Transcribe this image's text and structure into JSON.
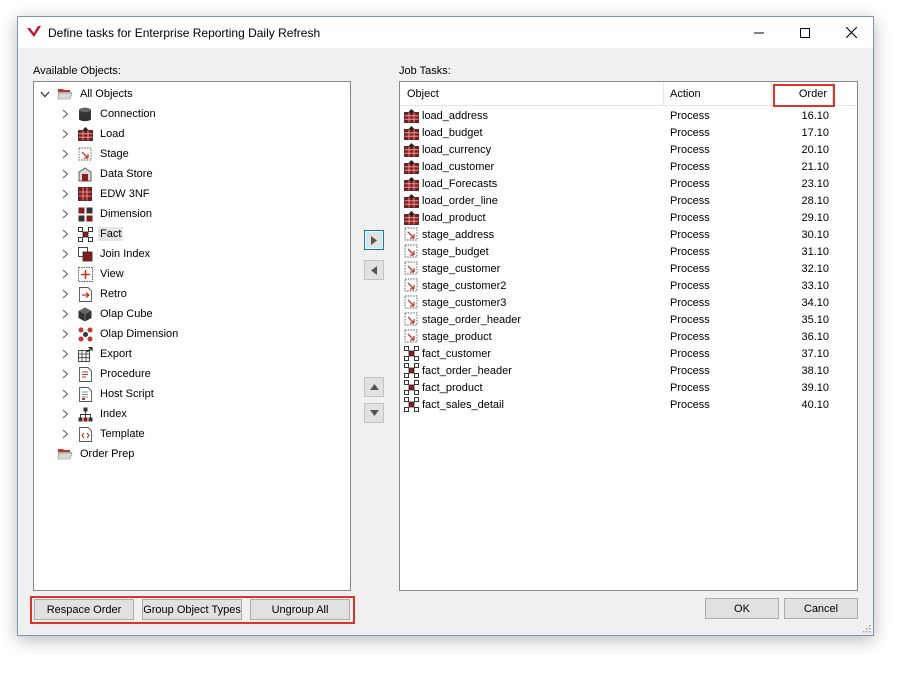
{
  "window": {
    "title": "Define tasks for Enterprise Reporting Daily Refresh"
  },
  "left": {
    "label": "Available Objects:",
    "tree": [
      {
        "label": "All Objects",
        "icon": "folder-icon",
        "expanded": true,
        "level": 0
      },
      {
        "label": "Connection",
        "icon": "connection-icon",
        "level": 1
      },
      {
        "label": "Load",
        "icon": "load-table-icon",
        "level": 1
      },
      {
        "label": "Stage",
        "icon": "stage-table-icon",
        "level": 1
      },
      {
        "label": "Data Store",
        "icon": "data-store-icon",
        "level": 1
      },
      {
        "label": "EDW 3NF",
        "icon": "edw-3nf-icon",
        "level": 1
      },
      {
        "label": "Dimension",
        "icon": "dimension-icon",
        "level": 1
      },
      {
        "label": "Fact",
        "icon": "fact-icon",
        "level": 1,
        "selected": true
      },
      {
        "label": "Join Index",
        "icon": "join-index-icon",
        "level": 1
      },
      {
        "label": "View",
        "icon": "view-icon",
        "level": 1
      },
      {
        "label": "Retro",
        "icon": "retro-icon",
        "level": 1
      },
      {
        "label": "Olap Cube",
        "icon": "olap-cube-icon",
        "level": 1
      },
      {
        "label": "Olap Dimension",
        "icon": "olap-dimension-icon",
        "level": 1
      },
      {
        "label": "Export",
        "icon": "export-icon",
        "level": 1
      },
      {
        "label": "Procedure",
        "icon": "procedure-icon",
        "level": 1
      },
      {
        "label": "Host Script",
        "icon": "host-script-icon",
        "level": 1
      },
      {
        "label": "Index",
        "icon": "index-icon",
        "level": 1
      },
      {
        "label": "Template",
        "icon": "template-icon",
        "level": 1
      },
      {
        "label": "Order Prep",
        "icon": "folder-icon",
        "level": 0,
        "nocaret": true
      }
    ],
    "buttons": {
      "respace": "Respace Order",
      "group": "Group Object Types",
      "ungroup": "Ungroup All"
    }
  },
  "middle": {
    "add_icon": "arrow-right-icon",
    "remove_icon": "arrow-left-icon",
    "up_icon": "arrow-up-icon",
    "down_icon": "arrow-down-icon"
  },
  "right": {
    "label": "Job Tasks:",
    "columns": [
      "Object",
      "Action",
      "Order"
    ],
    "rows": [
      {
        "object": "load_address",
        "action": "Process",
        "order": "16.10",
        "icon": "load-table-icon"
      },
      {
        "object": "load_budget",
        "action": "Process",
        "order": "17.10",
        "icon": "load-table-icon"
      },
      {
        "object": "load_currency",
        "action": "Process",
        "order": "20.10",
        "icon": "load-table-icon"
      },
      {
        "object": "load_customer",
        "action": "Process",
        "order": "21.10",
        "icon": "load-table-icon"
      },
      {
        "object": "load_Forecasts",
        "action": "Process",
        "order": "23.10",
        "icon": "load-table-icon"
      },
      {
        "object": "load_order_line",
        "action": "Process",
        "order": "28.10",
        "icon": "load-table-icon"
      },
      {
        "object": "load_product",
        "action": "Process",
        "order": "29.10",
        "icon": "load-table-icon"
      },
      {
        "object": "stage_address",
        "action": "Process",
        "order": "30.10",
        "icon": "stage-table-icon"
      },
      {
        "object": "stage_budget",
        "action": "Process",
        "order": "31.10",
        "icon": "stage-table-icon"
      },
      {
        "object": "stage_customer",
        "action": "Process",
        "order": "32.10",
        "icon": "stage-table-icon"
      },
      {
        "object": "stage_customer2",
        "action": "Process",
        "order": "33.10",
        "icon": "stage-table-icon"
      },
      {
        "object": "stage_customer3",
        "action": "Process",
        "order": "34.10",
        "icon": "stage-table-icon"
      },
      {
        "object": "stage_order_header",
        "action": "Process",
        "order": "35.10",
        "icon": "stage-table-icon"
      },
      {
        "object": "stage_product",
        "action": "Process",
        "order": "36.10",
        "icon": "stage-table-icon"
      },
      {
        "object": "fact_customer",
        "action": "Process",
        "order": "37.10",
        "icon": "fact-table-icon"
      },
      {
        "object": "fact_order_header",
        "action": "Process",
        "order": "38.10",
        "icon": "fact-table-icon"
      },
      {
        "object": "fact_product",
        "action": "Process",
        "order": "39.10",
        "icon": "fact-table-icon"
      },
      {
        "object": "fact_sales_detail",
        "action": "Process",
        "order": "40.10",
        "icon": "fact-table-icon"
      }
    ]
  },
  "footer": {
    "ok": "OK",
    "cancel": "Cancel"
  },
  "colors": {
    "highlight": "#d9352b",
    "load": "#8b1a1a",
    "window_border": "#7f93b8"
  }
}
